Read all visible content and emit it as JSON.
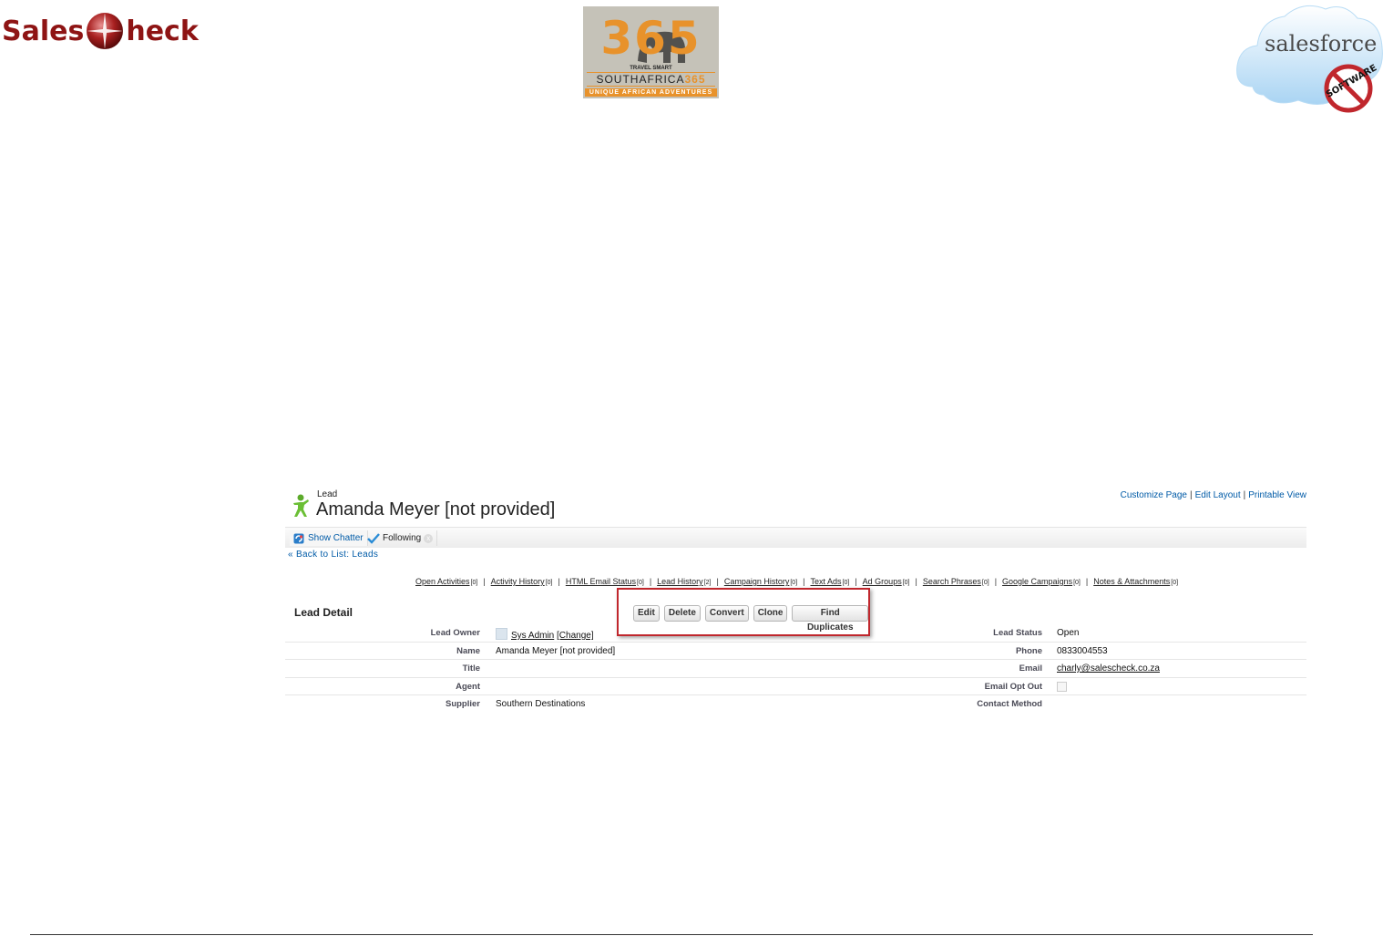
{
  "header": {
    "salescheck_logo": {
      "part1": "Sales",
      "part2": "heck",
      "brand_color": "#8e1414"
    },
    "sa365_logo": {
      "number": "365",
      "tagline_top": "TRAVEL SMART",
      "name_prefix": "SOUTHAFRICA",
      "name_suffix": "365",
      "tagline_bottom": "UNIQUE AFRICAN ADVENTURES",
      "accent_color": "#e8922b"
    },
    "salesforce_logo": {
      "text": "salesforce",
      "badge": "SOFTWARE"
    }
  },
  "lead_page": {
    "object_type": "Lead",
    "record_name": "Amanda Meyer [not provided]",
    "page_links": [
      "Customize Page",
      "Edit Layout",
      "Printable View"
    ],
    "chatter": {
      "show_label": "Show Chatter",
      "following_label": "Following",
      "close_icon": "x"
    },
    "back_prefix": "«",
    "back_link": "Back to List: Leads",
    "related_lists": [
      {
        "label": "Open Activities",
        "count": "[0]"
      },
      {
        "label": "Activity History",
        "count": "[0]"
      },
      {
        "label": "HTML Email Status",
        "count": "[0]"
      },
      {
        "label": "Lead History",
        "count": "[2]"
      },
      {
        "label": "Campaign History",
        "count": "[0]"
      },
      {
        "label": "Text Ads",
        "count": "[0]"
      },
      {
        "label": "Ad Groups",
        "count": "[0]"
      },
      {
        "label": "Search Phrases",
        "count": "[0]"
      },
      {
        "label": "Google Campaigns",
        "count": "[0]"
      },
      {
        "label": "Notes & Attachments",
        "count": "[0]"
      }
    ],
    "section_title": "Lead Detail",
    "buttons": [
      "Edit",
      "Delete",
      "Convert",
      "Clone",
      "Find Duplicates"
    ],
    "highlight_color": "#c0272d",
    "fields": {
      "lead_owner": {
        "label": "Lead Owner",
        "value": "Sys Admin",
        "change": "[Change]"
      },
      "name": {
        "label": "Name",
        "value": "Amanda Meyer [not provided]"
      },
      "title": {
        "label": "Title",
        "value": ""
      },
      "agent": {
        "label": "Agent",
        "value": ""
      },
      "supplier": {
        "label": "Supplier",
        "value": "Southern Destinations"
      },
      "lead_status": {
        "label": "Lead Status",
        "value": "Open"
      },
      "phone": {
        "label": "Phone",
        "value": "0833004553"
      },
      "email": {
        "label": "Email",
        "value": "charly@salescheck.co.za"
      },
      "email_opt_out": {
        "label": "Email Opt Out",
        "checked": false
      },
      "contact_method": {
        "label": "Contact Method",
        "value": ""
      }
    },
    "link_color": "#015ba7"
  }
}
